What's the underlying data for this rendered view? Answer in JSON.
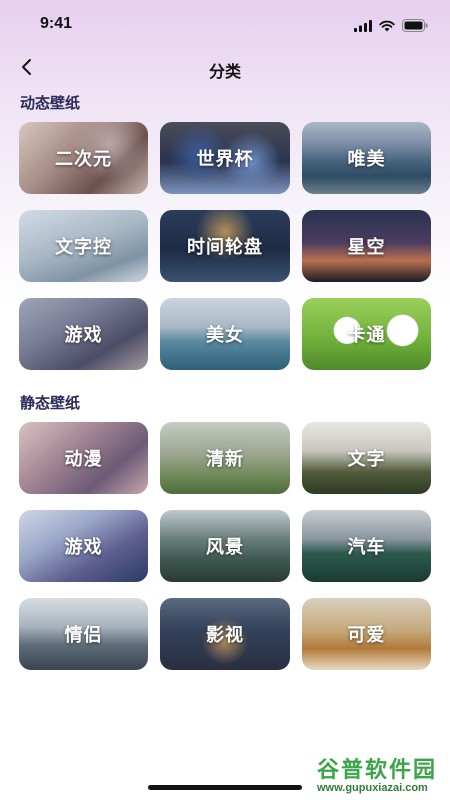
{
  "status_bar": {
    "time": "9:41"
  },
  "header": {
    "title": "分类"
  },
  "sections": [
    {
      "title": "动态壁纸",
      "items": [
        {
          "label": "二次元"
        },
        {
          "label": "世界杯"
        },
        {
          "label": "唯美"
        },
        {
          "label": "文字控"
        },
        {
          "label": "时间轮盘"
        },
        {
          "label": "星空"
        },
        {
          "label": "游戏"
        },
        {
          "label": "美女"
        },
        {
          "label": "卡通"
        }
      ]
    },
    {
      "title": "静态壁纸",
      "items": [
        {
          "label": "动漫"
        },
        {
          "label": "清新"
        },
        {
          "label": "文字"
        },
        {
          "label": "游戏"
        },
        {
          "label": "风景"
        },
        {
          "label": "汽车"
        },
        {
          "label": "情侣"
        },
        {
          "label": "影视"
        },
        {
          "label": "可爱"
        }
      ]
    }
  ],
  "watermark": {
    "name": "谷普软件园",
    "url": "www.gupuxiazai.com"
  }
}
